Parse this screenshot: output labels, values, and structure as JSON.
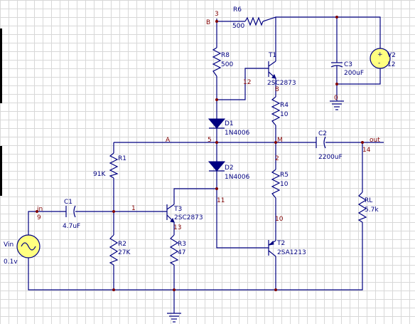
{
  "nodes": {
    "b_num": "3",
    "b_name": "B",
    "a_name": "A",
    "a_num": "5",
    "m_name": "M",
    "m_num": "2",
    "n12": "12",
    "n8": "8",
    "n11": "11",
    "n1": "1",
    "n13": "13",
    "n10": "10",
    "n0": "0",
    "in_name": "in",
    "in_num": "9",
    "out_name": "out",
    "out_num": "14"
  },
  "components": {
    "R6": {
      "ref": "R6",
      "value": "500"
    },
    "R8": {
      "ref": "R8",
      "value": "500"
    },
    "T1": {
      "ref": "T1",
      "value": "2SC2873"
    },
    "C3": {
      "ref": "C3",
      "value": "200uF"
    },
    "V2": {
      "ref": "V2",
      "value": "12"
    },
    "R4": {
      "ref": "R4",
      "value": "10"
    },
    "D1": {
      "ref": "D1",
      "value": "1N4006"
    },
    "C2": {
      "ref": "C2",
      "value": "2200uF"
    },
    "R1": {
      "ref": "R1",
      "value": "91K"
    },
    "D2": {
      "ref": "D2",
      "value": "1N4006"
    },
    "R5": {
      "ref": "R5",
      "value": "10"
    },
    "C1": {
      "ref": "C1",
      "value": "4.7uF"
    },
    "T3": {
      "ref": "T3",
      "value": "2SC2873"
    },
    "RL": {
      "ref": "RL",
      "value": "5.7k"
    },
    "R2": {
      "ref": "R2",
      "value": "27K"
    },
    "R3": {
      "ref": "R3",
      "value": "47"
    },
    "T2": {
      "ref": "T2",
      "value": "2SA1213"
    },
    "Vin": {
      "ref": "Vin",
      "value": "0.1v"
    }
  },
  "colors": {
    "wire": "#000080",
    "node_label": "#800000",
    "junction": "#800000",
    "grid": "#d8d8d8"
  }
}
